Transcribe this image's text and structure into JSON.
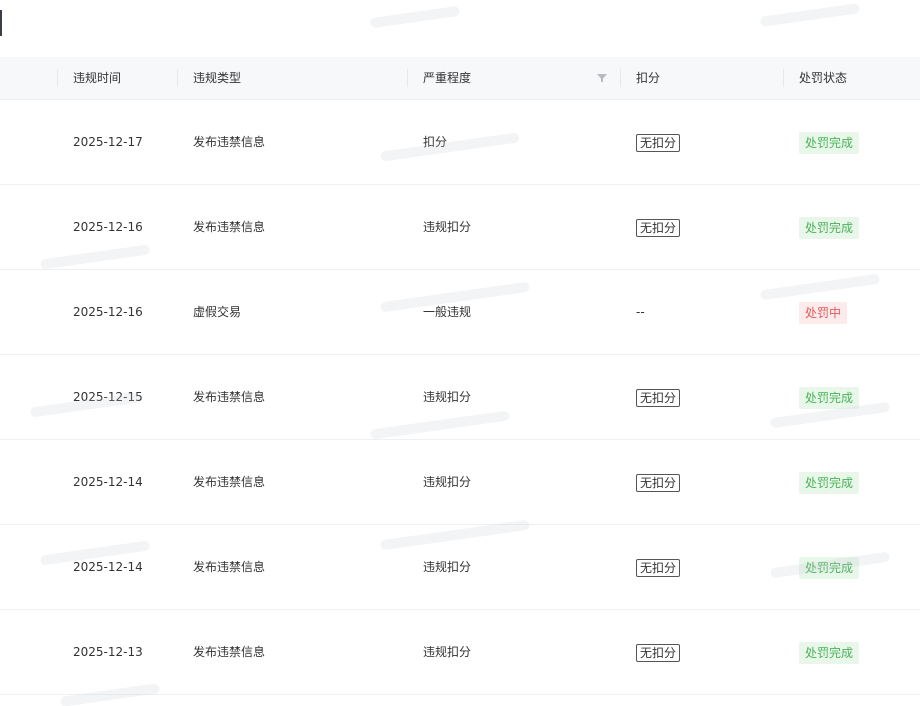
{
  "table": {
    "headers": {
      "time": "违规时间",
      "type": "违规类型",
      "severity": "严重程度",
      "deduction": "扣分",
      "status": "处罚状态"
    },
    "rows": [
      {
        "time": "2025-12-17",
        "type": "发布违禁信息",
        "severity": "扣分",
        "deduction": "无扣分",
        "status": "处罚完成",
        "status_kind": "done"
      },
      {
        "time": "2025-12-16",
        "type": "发布违禁信息",
        "severity": "违规扣分",
        "deduction": "无扣分",
        "status": "处罚完成",
        "status_kind": "done"
      },
      {
        "time": "2025-12-16",
        "type": "虚假交易",
        "severity": "一般违规",
        "deduction": "--",
        "status": "处罚中",
        "status_kind": "pending"
      },
      {
        "time": "2025-12-15",
        "type": "发布违禁信息",
        "severity": "违规扣分",
        "deduction": "无扣分",
        "status": "处罚完成",
        "status_kind": "done"
      },
      {
        "time": "2025-12-14",
        "type": "发布违禁信息",
        "severity": "违规扣分",
        "deduction": "无扣分",
        "status": "处罚完成",
        "status_kind": "done"
      },
      {
        "time": "2025-12-14",
        "type": "发布违禁信息",
        "severity": "违规扣分",
        "deduction": "无扣分",
        "status": "处罚完成",
        "status_kind": "done"
      },
      {
        "time": "2025-12-13",
        "type": "发布违禁信息",
        "severity": "违规扣分",
        "deduction": "无扣分",
        "status": "处罚完成",
        "status_kind": "done"
      }
    ]
  },
  "colors": {
    "header_bg": "#f7f8fa",
    "done_bg": "#e8f7e9",
    "done_text": "#4bb35a",
    "pending_bg": "#fdeaea",
    "pending_text": "#e05c5c"
  },
  "icons": {
    "severity_filter": "filter-icon"
  }
}
